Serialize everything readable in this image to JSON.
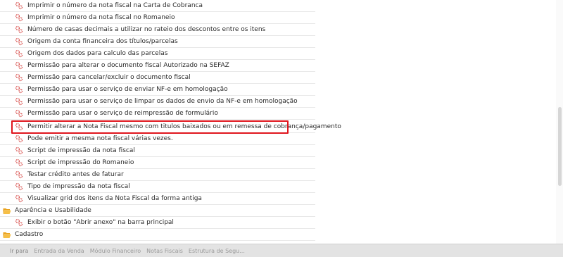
{
  "tree": {
    "items": [
      {
        "label": "Imprimir o número da nota fiscal na Carta de Cobranca",
        "icon": "config-gears-icon"
      },
      {
        "label": "Imprimir o número da nota fiscal no Romaneio",
        "icon": "config-gears-icon"
      },
      {
        "label": "Número de casas decimais a utilizar no rateio dos descontos entre os itens",
        "icon": "config-gears-icon"
      },
      {
        "label": "Origem da conta financeira dos títulos/parcelas",
        "icon": "config-gears-icon"
      },
      {
        "label": "Origem dos dados para calculo das parcelas",
        "icon": "config-gears-icon"
      },
      {
        "label": "Permissão para alterar o documento fiscal Autorizado na SEFAZ",
        "icon": "config-gears-icon"
      },
      {
        "label": "Permissão para cancelar/excluir o documento fiscal",
        "icon": "config-gears-icon"
      },
      {
        "label": "Permissão para usar o serviço de enviar NF-e em homologação",
        "icon": "config-gears-icon"
      },
      {
        "label": "Permissão para usar o serviço de limpar os dados de envio da NF-e em homologação",
        "icon": "config-gears-icon"
      },
      {
        "label": "Permissão para usar o serviço de reimpressão de formulário",
        "icon": "config-gears-icon"
      },
      {
        "label": "Permitir alterar a Nota Fiscal mesmo com titulos baixados ou em remessa de cobrança/pagamento",
        "icon": "config-gears-icon"
      },
      {
        "label": "Pode emitir a mesma nota fiscal várias vezes.",
        "icon": "config-gears-icon"
      },
      {
        "label": "Script de impressão da nota fiscal",
        "icon": "config-gears-icon"
      },
      {
        "label": "Script de impressão do Romaneio",
        "icon": "config-gears-icon"
      },
      {
        "label": "Testar crédito antes de faturar",
        "icon": "config-gears-icon"
      },
      {
        "label": "Tipo de impressão da nota fiscal",
        "icon": "config-gears-icon"
      },
      {
        "label": "Visualizar grid dos itens da Nota Fiscal da forma antiga",
        "icon": "config-gears-icon"
      },
      {
        "label": "Aparência e Usabilidade",
        "icon": "folder-open-icon"
      },
      {
        "label": "Exibir o botão \"Abrir anexo\" na barra principal",
        "icon": "config-gears-icon"
      },
      {
        "label": "Cadastro",
        "icon": "folder-open-icon"
      }
    ]
  },
  "taskbar": {
    "tabs": [
      "Ir para",
      "Entrada da Venda",
      "Módulo Financeiro",
      "Notas Fiscais",
      "Estrutura de Segu..."
    ]
  },
  "colors": {
    "highlight": "#e0161e",
    "gears_icon": "#d8504d",
    "folder_icon": "#f2b132"
  }
}
